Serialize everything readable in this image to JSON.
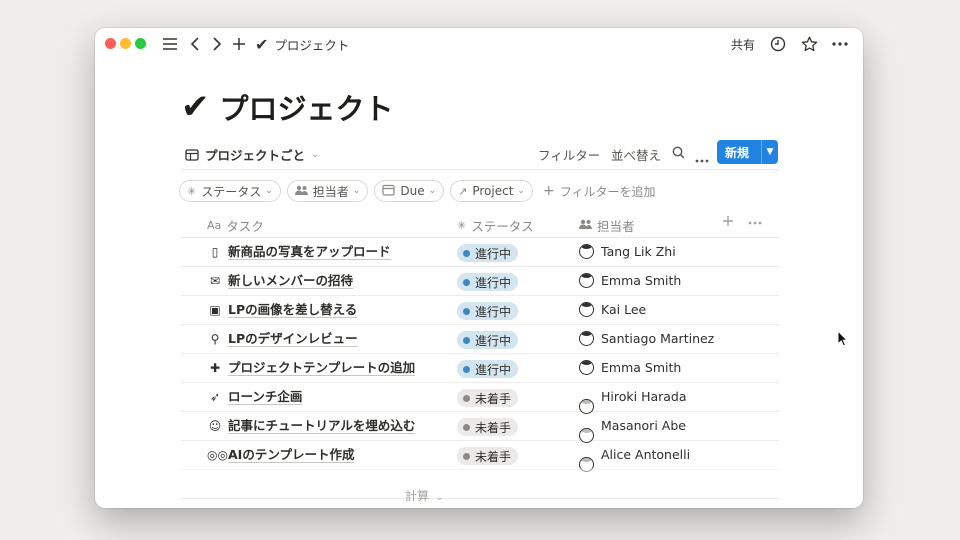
{
  "window": {
    "title": "プロジェクト",
    "share_label": "共有"
  },
  "page": {
    "title": "プロジェクト"
  },
  "view": {
    "tab_label": "プロジェクトごと",
    "filter_label": "フィルター",
    "sort_label": "並べ替え",
    "new_label": "新規"
  },
  "filters": {
    "chips": [
      {
        "label": "ステータス",
        "icon": "status-icon"
      },
      {
        "label": "担当者",
        "icon": "people-icon"
      },
      {
        "label": "Due",
        "icon": "calendar-icon"
      },
      {
        "label": "Project",
        "icon": "arrow-up-right-icon"
      }
    ],
    "add_label": "フィルターを追加"
  },
  "table": {
    "columns": {
      "name_prefix": "Aa",
      "name": "タスク",
      "status": "ステータス",
      "assignee": "担当者"
    },
    "rows": [
      {
        "emoji": "▯",
        "icon": "phone-icon",
        "name": "新商品の写真をアップロード",
        "status": "進行中",
        "status_type": "active",
        "assignee": "Tang Lik Zhi"
      },
      {
        "emoji": "✉",
        "icon": "envelope-icon",
        "name": "新しいメンバーの招待",
        "status": "進行中",
        "status_type": "active",
        "assignee": "Emma Smith"
      },
      {
        "emoji": "▣",
        "icon": "picture-icon",
        "name": "LPの画像を差し替える",
        "status": "進行中",
        "status_type": "active",
        "assignee": "Kai Lee"
      },
      {
        "emoji": "⚲",
        "icon": "magnifier-icon",
        "name": "LPのデザインレビュー",
        "status": "進行中",
        "status_type": "active",
        "assignee": "Santiago Martinez"
      },
      {
        "emoji": "✚",
        "icon": "plus-icon",
        "name": "プロジェクトテンプレートの追加",
        "status": "進行中",
        "status_type": "active",
        "assignee": "Emma Smith"
      },
      {
        "emoji": "➶",
        "icon": "rocket-icon",
        "name": "ローンチ企画",
        "status": "未着手",
        "status_type": "idle",
        "assignee": "Hiroki Harada"
      },
      {
        "emoji": "☺",
        "icon": "teacher-icon",
        "name": "記事にチュートリアルを埋め込む",
        "status": "未着手",
        "status_type": "idle",
        "assignee": "Masanori Abe"
      },
      {
        "emoji": "◎◎",
        "icon": "glasses-icon",
        "name": "AIのテンプレート作成",
        "status": "未着手",
        "status_type": "idle",
        "assignee": "Alice Antonelli"
      }
    ]
  },
  "footer": {
    "calc_label": "計算"
  },
  "colors": {
    "accent": "#2383e2",
    "active_badge": "#d3e5ef",
    "idle_badge": "#ebeae8"
  }
}
